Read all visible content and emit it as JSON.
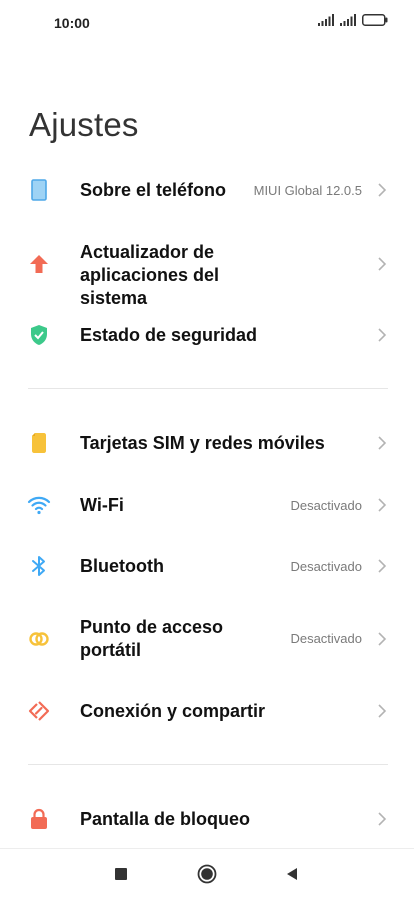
{
  "status_bar": {
    "time": "10:00",
    "signal_1_icon": "signal-icon",
    "signal_2_icon": "signal-icon",
    "battery_icon": "battery-icon"
  },
  "title": "Ajustes",
  "items": [
    {
      "id": "about",
      "label": "Sobre el teléfono",
      "value": "MIUI Global 12.0.5",
      "icon": "phone-icon",
      "color": "#4FA8E8"
    },
    {
      "id": "updater",
      "label": "Actualizador de aplicaciones del sistema",
      "value": "",
      "icon": "arrow-up-icon",
      "color": "#F26B55"
    },
    {
      "id": "security",
      "label": "Estado de seguridad",
      "value": "",
      "icon": "shield-check-icon",
      "color": "#3CC98A"
    },
    {
      "id": "sim",
      "label": "Tarjetas SIM y redes móviles",
      "value": "",
      "icon": "sim-card-icon",
      "color": "#F7C23A"
    },
    {
      "id": "wifi",
      "label": "Wi-Fi",
      "value": "Desactivado",
      "icon": "wifi-icon",
      "color": "#3FA9F5"
    },
    {
      "id": "bluetooth",
      "label": "Bluetooth",
      "value": "Desactivado",
      "icon": "bluetooth-icon",
      "color": "#3FA9F5"
    },
    {
      "id": "hotspot",
      "label": "Punto de acceso portátil",
      "value": "Desactivado",
      "icon": "hotspot-icon",
      "color": "#F7C23A"
    },
    {
      "id": "share",
      "label": "Conexión y compartir",
      "value": "",
      "icon": "share-icon",
      "color": "#F26B55"
    },
    {
      "id": "lock",
      "label": "Pantalla de bloqueo",
      "value": "",
      "icon": "lock-icon",
      "color": "#F26B55"
    }
  ],
  "nav": {
    "recents_icon": "recents-icon",
    "home_icon": "home-icon",
    "back_icon": "back-icon"
  }
}
